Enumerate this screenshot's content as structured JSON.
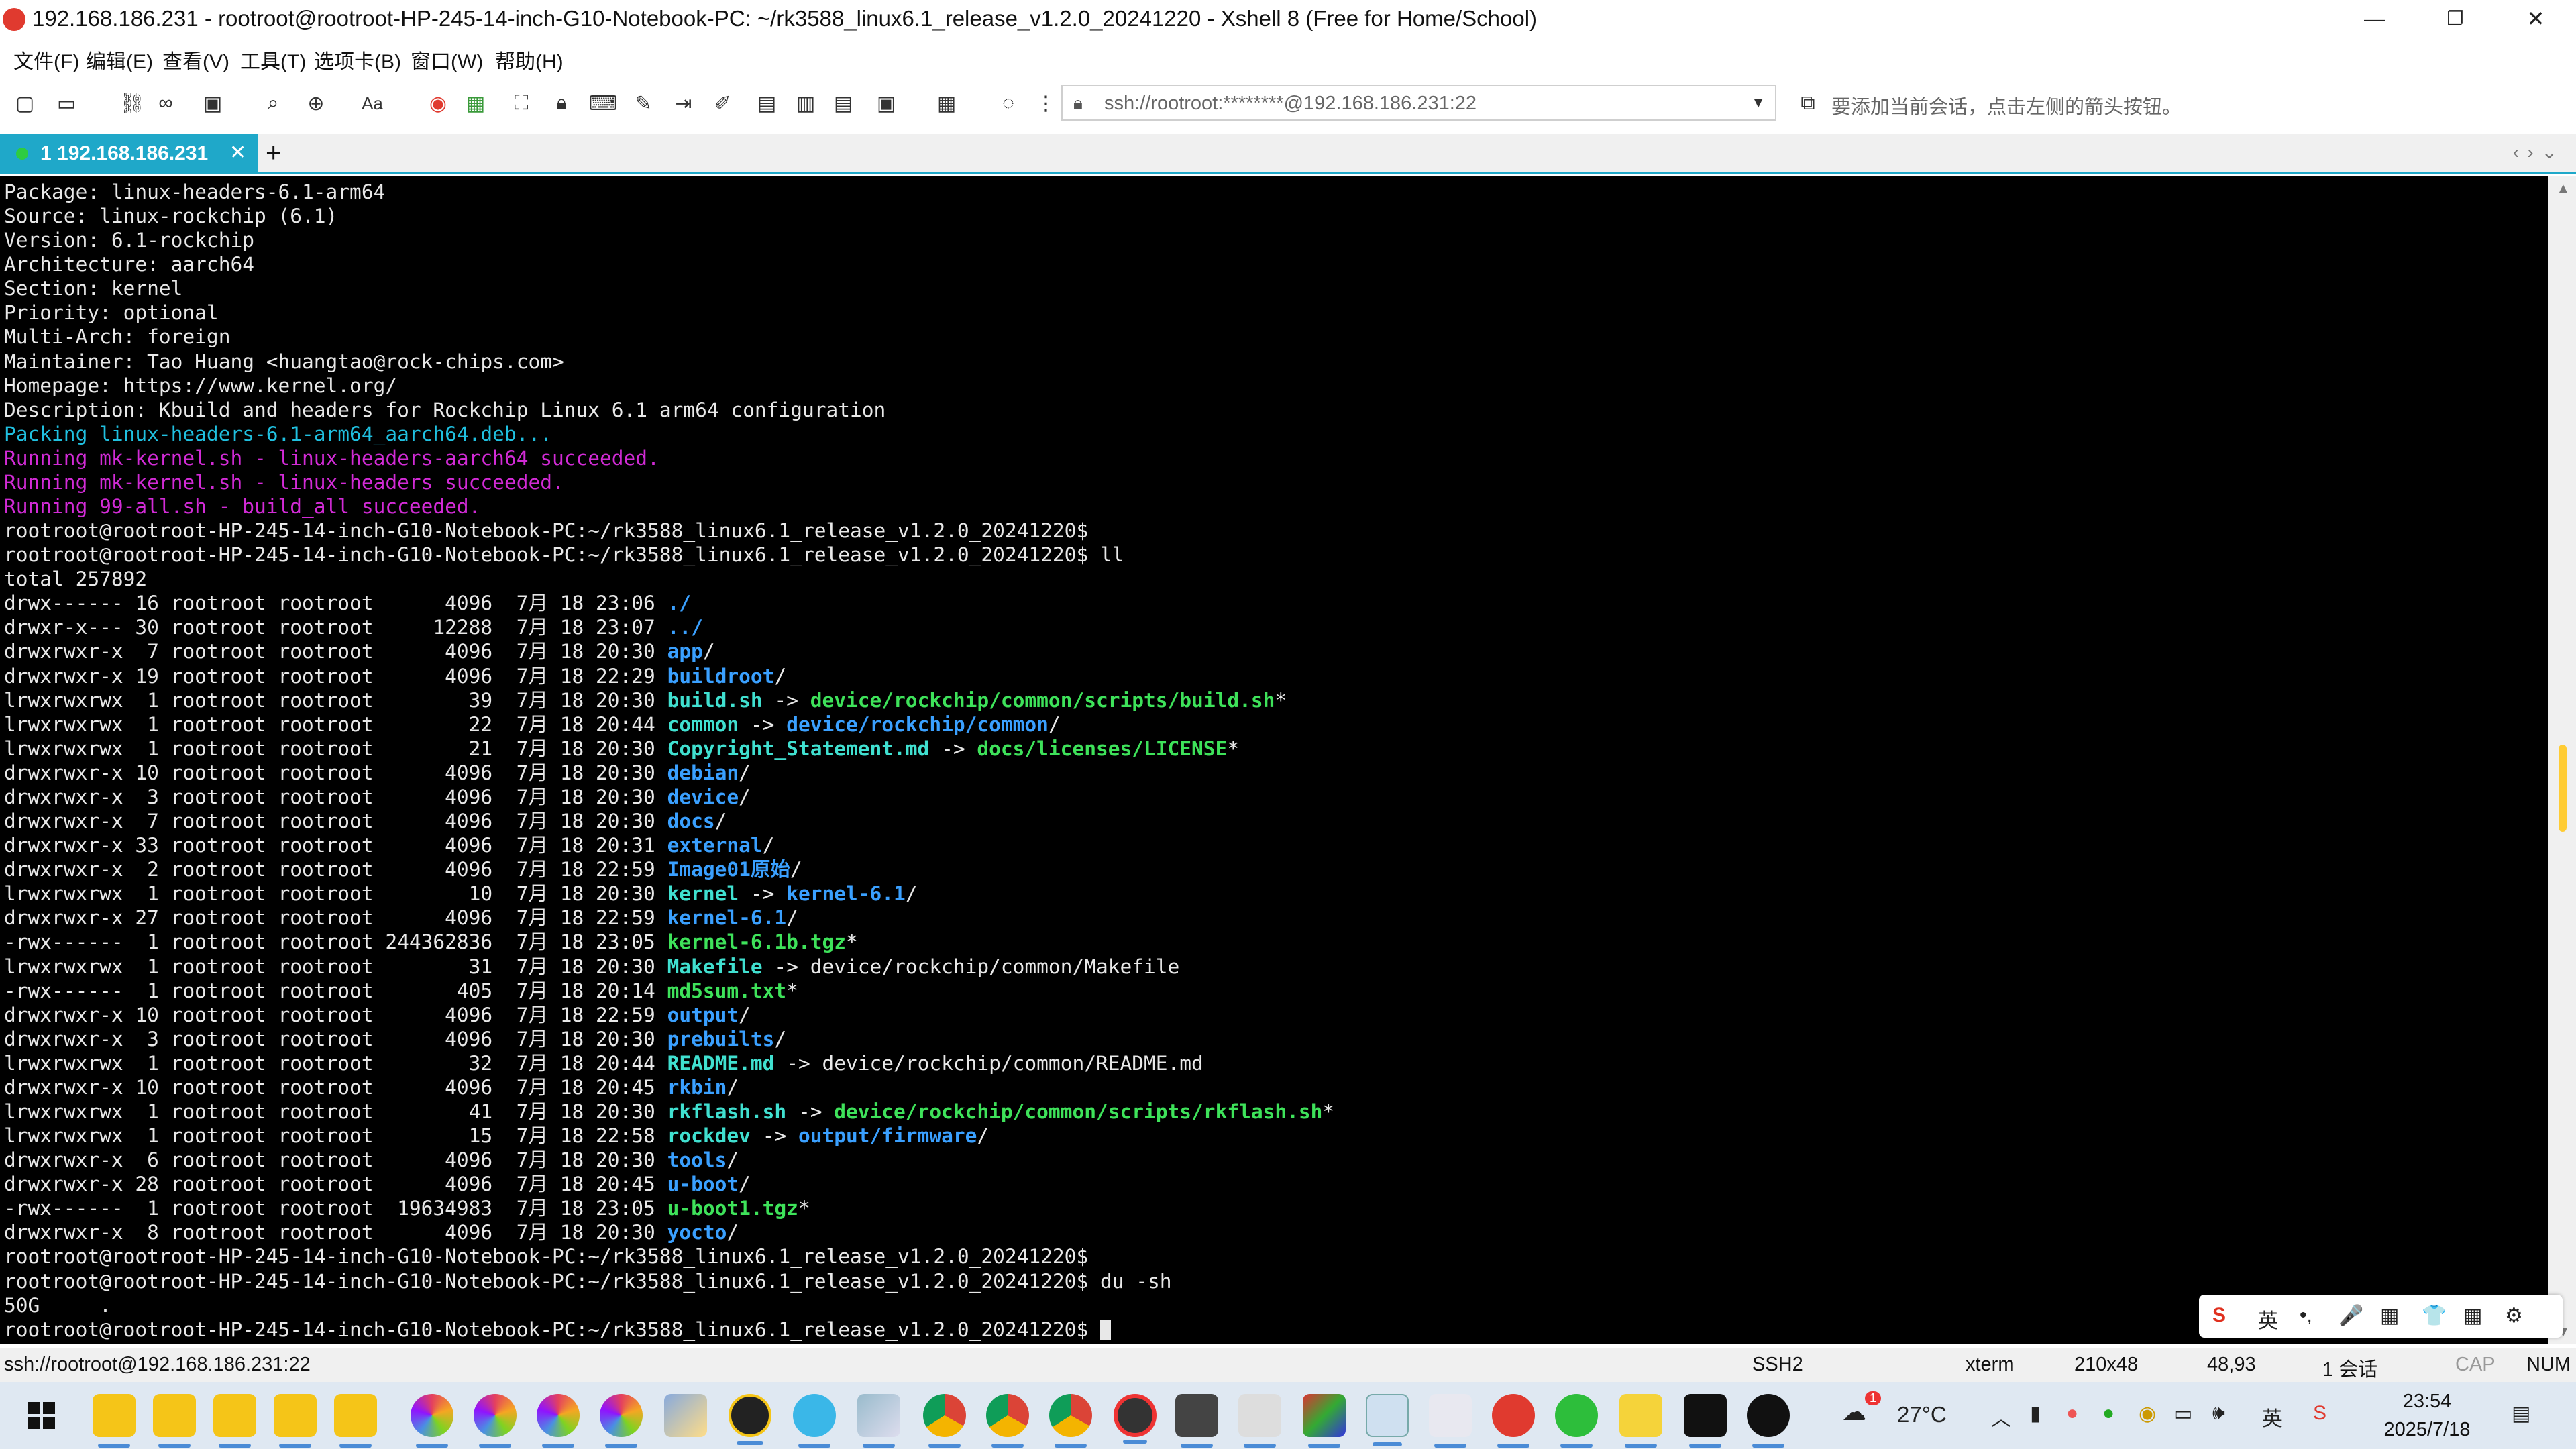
{
  "window": {
    "title": "192.168.186.231 - rootroot@rootroot-HP-245-14-inch-G10-Notebook-PC: ~/rk3588_linux6.1_release_v1.2.0_20241220 - Xshell 8 (Free for Home/School)",
    "minimize": "—",
    "maximize": "❐",
    "close": "✕"
  },
  "menu": [
    "文件(F)",
    "编辑(E)",
    "查看(V)",
    "工具(T)",
    "选项卡(B)",
    "窗口(W)",
    "帮助(H)"
  ],
  "toolbar": {
    "address": "ssh://rootroot:********@192.168.186.231:22",
    "hint": "要添加当前会话，点击左侧的箭头按钮。"
  },
  "tabs": [
    {
      "label": "1 192.168.186.231",
      "close": "✕"
    }
  ],
  "tab_add": "+",
  "terminal": {
    "lines": [
      [
        {
          "t": "Package: linux-headers-6.1-arm64"
        }
      ],
      [
        {
          "t": "Source: linux-rockchip (6.1)"
        }
      ],
      [
        {
          "t": "Version: 6.1-rockchip"
        }
      ],
      [
        {
          "t": "Architecture: aarch64"
        }
      ],
      [
        {
          "t": "Section: kernel"
        }
      ],
      [
        {
          "t": "Priority: optional"
        }
      ],
      [
        {
          "t": "Multi-Arch: foreign"
        }
      ],
      [
        {
          "t": "Maintainer: Tao Huang <huangtao@rock-chips.com>"
        }
      ],
      [
        {
          "t": "Homepage: https://www.kernel.org/"
        }
      ],
      [
        {
          "t": "Description: Kbuild and headers for Rockchip Linux 6.1 arm64 configuration"
        }
      ],
      [
        {
          "t": "Packing linux-headers-6.1-arm64_aarch64.deb...",
          "c": "cyan"
        }
      ],
      [
        {
          "t": "Running mk-kernel.sh - linux-headers-aarch64 succeeded.",
          "c": "mag"
        }
      ],
      [
        {
          "t": "Running mk-kernel.sh - linux-headers succeeded.",
          "c": "mag"
        }
      ],
      [
        {
          "t": "Running 99-all.sh - build_all succeeded.",
          "c": "mag"
        }
      ],
      [
        {
          "t": "rootroot@rootroot-HP-245-14-inch-G10-Notebook-PC:~/rk3588_linux6.1_release_v1.2.0_20241220$"
        }
      ],
      [
        {
          "t": "rootroot@rootroot-HP-245-14-inch-G10-Notebook-PC:~/rk3588_linux6.1_release_v1.2.0_20241220$ ll"
        }
      ],
      [
        {
          "t": "total 257892"
        }
      ],
      [
        {
          "t": "drwx------ 16 rootroot rootroot      4096  7月 18 23:06 "
        },
        {
          "t": "./",
          "c": "bluedir"
        }
      ],
      [
        {
          "t": "drwxr-x--- 30 rootroot rootroot     12288  7月 18 23:07 "
        },
        {
          "t": "../",
          "c": "bluedir"
        }
      ],
      [
        {
          "t": "drwxrwxr-x  7 rootroot rootroot      4096  7月 18 20:30 "
        },
        {
          "t": "app",
          "c": "bluedir"
        },
        {
          "t": "/"
        }
      ],
      [
        {
          "t": "drwxrwxr-x 19 rootroot rootroot      4096  7月 18 22:29 "
        },
        {
          "t": "buildroot",
          "c": "bluedir"
        },
        {
          "t": "/"
        }
      ],
      [
        {
          "t": "lrwxrwxrwx  1 rootroot rootroot        39  7月 18 20:30 "
        },
        {
          "t": "build.sh",
          "c": "link"
        },
        {
          "t": " -> "
        },
        {
          "t": "device/rockchip/common/scripts/build.sh",
          "c": "exec"
        },
        {
          "t": "*"
        }
      ],
      [
        {
          "t": "lrwxrwxrwx  1 rootroot rootroot        22  7月 18 20:44 "
        },
        {
          "t": "common",
          "c": "link"
        },
        {
          "t": " -> "
        },
        {
          "t": "device/rockchip/common",
          "c": "bluedir"
        },
        {
          "t": "/"
        }
      ],
      [
        {
          "t": "lrwxrwxrwx  1 rootroot rootroot        21  7月 18 20:30 "
        },
        {
          "t": "Copyright_Statement.md",
          "c": "link"
        },
        {
          "t": " -> "
        },
        {
          "t": "docs/licenses/LICENSE",
          "c": "exec"
        },
        {
          "t": "*"
        }
      ],
      [
        {
          "t": "drwxrwxr-x 10 rootroot rootroot      4096  7月 18 20:30 "
        },
        {
          "t": "debian",
          "c": "bluedir"
        },
        {
          "t": "/"
        }
      ],
      [
        {
          "t": "drwxrwxr-x  3 rootroot rootroot      4096  7月 18 20:30 "
        },
        {
          "t": "device",
          "c": "bluedir"
        },
        {
          "t": "/"
        }
      ],
      [
        {
          "t": "drwxrwxr-x  7 rootroot rootroot      4096  7月 18 20:30 "
        },
        {
          "t": "docs",
          "c": "bluedir"
        },
        {
          "t": "/"
        }
      ],
      [
        {
          "t": "drwxrwxr-x 33 rootroot rootroot      4096  7月 18 20:31 "
        },
        {
          "t": "external",
          "c": "bluedir"
        },
        {
          "t": "/"
        }
      ],
      [
        {
          "t": "drwxrwxr-x  2 rootroot rootroot      4096  7月 18 22:59 "
        },
        {
          "t": "Image01原始",
          "c": "bluedir"
        },
        {
          "t": "/"
        }
      ],
      [
        {
          "t": "lrwxrwxrwx  1 rootroot rootroot        10  7月 18 20:30 "
        },
        {
          "t": "kernel",
          "c": "link"
        },
        {
          "t": " -> "
        },
        {
          "t": "kernel-6.1",
          "c": "bluedir"
        },
        {
          "t": "/"
        }
      ],
      [
        {
          "t": "drwxrwxr-x 27 rootroot rootroot      4096  7月 18 22:59 "
        },
        {
          "t": "kernel-6.1",
          "c": "bluedir"
        },
        {
          "t": "/"
        }
      ],
      [
        {
          "t": "-rwx------  1 rootroot rootroot 244362836  7月 18 23:05 "
        },
        {
          "t": "kernel-6.1b.tgz",
          "c": "exec"
        },
        {
          "t": "*"
        }
      ],
      [
        {
          "t": "lrwxrwxrwx  1 rootroot rootroot        31  7月 18 20:30 "
        },
        {
          "t": "Makefile",
          "c": "link"
        },
        {
          "t": " -> device/rockchip/common/Makefile"
        }
      ],
      [
        {
          "t": "-rwx------  1 rootroot rootroot       405  7月 18 20:14 "
        },
        {
          "t": "md5sum.txt",
          "c": "exec"
        },
        {
          "t": "*"
        }
      ],
      [
        {
          "t": "drwxrwxr-x 10 rootroot rootroot      4096  7月 18 22:59 "
        },
        {
          "t": "output",
          "c": "bluedir"
        },
        {
          "t": "/"
        }
      ],
      [
        {
          "t": "drwxrwxr-x  3 rootroot rootroot      4096  7月 18 20:30 "
        },
        {
          "t": "prebuilts",
          "c": "bluedir"
        },
        {
          "t": "/"
        }
      ],
      [
        {
          "t": "lrwxrwxrwx  1 rootroot rootroot        32  7月 18 20:44 "
        },
        {
          "t": "README.md",
          "c": "link"
        },
        {
          "t": " -> device/rockchip/common/README.md"
        }
      ],
      [
        {
          "t": "drwxrwxr-x 10 rootroot rootroot      4096  7月 18 20:45 "
        },
        {
          "t": "rkbin",
          "c": "bluedir"
        },
        {
          "t": "/"
        }
      ],
      [
        {
          "t": "lrwxrwxrwx  1 rootroot rootroot        41  7月 18 20:30 "
        },
        {
          "t": "rkflash.sh",
          "c": "link"
        },
        {
          "t": " -> "
        },
        {
          "t": "device/rockchip/common/scripts/rkflash.sh",
          "c": "exec"
        },
        {
          "t": "*"
        }
      ],
      [
        {
          "t": "lrwxrwxrwx  1 rootroot rootroot        15  7月 18 22:58 "
        },
        {
          "t": "rockdev",
          "c": "link"
        },
        {
          "t": " -> "
        },
        {
          "t": "output/firmware",
          "c": "bluedir"
        },
        {
          "t": "/"
        }
      ],
      [
        {
          "t": "drwxrwxr-x  6 rootroot rootroot      4096  7月 18 20:30 "
        },
        {
          "t": "tools",
          "c": "bluedir"
        },
        {
          "t": "/"
        }
      ],
      [
        {
          "t": "drwxrwxr-x 28 rootroot rootroot      4096  7月 18 20:45 "
        },
        {
          "t": "u-boot",
          "c": "bluedir"
        },
        {
          "t": "/"
        }
      ],
      [
        {
          "t": "-rwx------  1 rootroot rootroot  19634983  7月 18 23:05 "
        },
        {
          "t": "u-boot1.tgz",
          "c": "exec"
        },
        {
          "t": "*"
        }
      ],
      [
        {
          "t": "drwxrwxr-x  8 rootroot rootroot      4096  7月 18 20:30 "
        },
        {
          "t": "yocto",
          "c": "bluedir"
        },
        {
          "t": "/"
        }
      ],
      [
        {
          "t": "rootroot@rootroot-HP-245-14-inch-G10-Notebook-PC:~/rk3588_linux6.1_release_v1.2.0_20241220$"
        }
      ],
      [
        {
          "t": "rootroot@rootroot-HP-245-14-inch-G10-Notebook-PC:~/rk3588_linux6.1_release_v1.2.0_20241220$ du -sh"
        }
      ],
      [
        {
          "t": "50G     ."
        }
      ],
      [
        {
          "t": "rootroot@rootroot-HP-245-14-inch-G10-Notebook-PC:~/rk3588_linux6.1_release_v1.2.0_20241220$ "
        }
      ]
    ]
  },
  "ime": [
    "S",
    "英",
    "•,",
    "🎤",
    "▦",
    "👕",
    "▦",
    "⚙"
  ],
  "statusbar": {
    "connection": "ssh://rootroot@192.168.186.231:22",
    "protocol": "SSH2",
    "term": "xterm",
    "size": "210x48",
    "cursor": "48,93",
    "sessions": "1 会话",
    "caps": "CAP",
    "num": "NUM"
  },
  "taskbar": {
    "weather": "27°C",
    "time": "23:54",
    "date": "2025/7/18",
    "weather_badge": "1"
  },
  "colors": {
    "accent": "#1fa8c9",
    "terminal_bg": "#000000",
    "magenta": "#d22bd6",
    "cyan": "#20c0e0"
  }
}
